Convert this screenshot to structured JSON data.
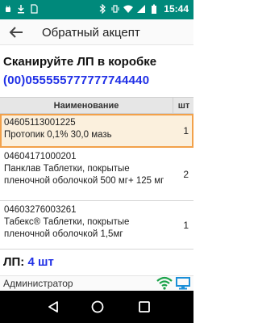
{
  "status_bar": {
    "time": "15:44",
    "left_icons": [
      "android-debug-icon",
      "download-icon",
      "sim-icon"
    ],
    "right_icons": [
      "bluetooth-icon",
      "vibrate-icon",
      "wifi-icon",
      "signal-icon",
      "battery-icon"
    ]
  },
  "toolbar": {
    "title": "Обратный акцепт"
  },
  "scan": {
    "heading": "Сканируйте ЛП в коробке",
    "code": "(00)055555777777744440"
  },
  "table": {
    "columns": [
      "Наименование",
      "шт"
    ],
    "rows": [
      {
        "code": "04605113001225",
        "name": "Протопик 0,1% 30,0 мазь",
        "qty": "1",
        "selected": true
      },
      {
        "code": "04604171000201",
        "name": "Панклав Таблетки, покрытые пленочной оболочкой 500 мг+ 125 мг",
        "qty": "2",
        "selected": false
      },
      {
        "code": "04603276003261",
        "name": "Табекс® Таблетки, покрытые пленочной оболочкой 1,5мг",
        "qty": "1",
        "selected": false
      }
    ]
  },
  "summary": {
    "label": "ЛП:",
    "value": "4 шт"
  },
  "footer": {
    "user": "Администратор"
  },
  "colors": {
    "status_bar": "#00897b",
    "accent_blue": "#1f2fe6",
    "selection_border": "#f2a14a",
    "selection_fill": "#fbf0dd",
    "wifi_icon": "#1aa34a",
    "monitor_icon": "#1b8fd8"
  }
}
